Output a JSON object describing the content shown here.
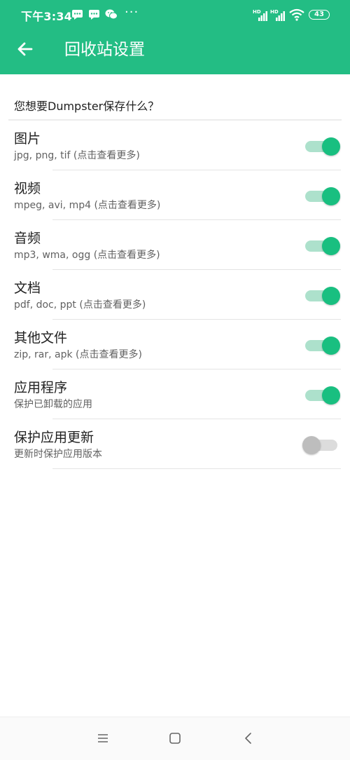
{
  "status_bar": {
    "time": "下午3:34",
    "more_dots": "···",
    "battery": "43"
  },
  "app_bar": {
    "title": "回收站设置",
    "back_icon": "arrow-left-icon"
  },
  "section": {
    "header": "您想要Dumpster保存什么？"
  },
  "settings": [
    {
      "title": "图片",
      "subtitle": "jpg, png, tif (点击查看更多)",
      "enabled": true
    },
    {
      "title": "视频",
      "subtitle": "mpeg, avi, mp4 (点击查看更多)",
      "enabled": true
    },
    {
      "title": "音频",
      "subtitle": "mp3, wma, ogg (点击查看更多)",
      "enabled": true
    },
    {
      "title": "文档",
      "subtitle": "pdf, doc, ppt (点击查看更多)",
      "enabled": true
    },
    {
      "title": "其他文件",
      "subtitle": "zip, rar, apk (点击查看更多)",
      "enabled": true
    },
    {
      "title": "应用程序",
      "subtitle": "保护已卸载的应用",
      "enabled": true
    },
    {
      "title": "保护应用更新",
      "subtitle": "更新时保护应用版本",
      "enabled": false
    }
  ],
  "colors": {
    "accent": "#23bd84",
    "switch_on": "#19bf80",
    "switch_off": "#bdbdbd"
  },
  "nav_bar": {
    "icons": [
      "menu-icon",
      "home-square-icon",
      "back-chevron-icon"
    ]
  }
}
